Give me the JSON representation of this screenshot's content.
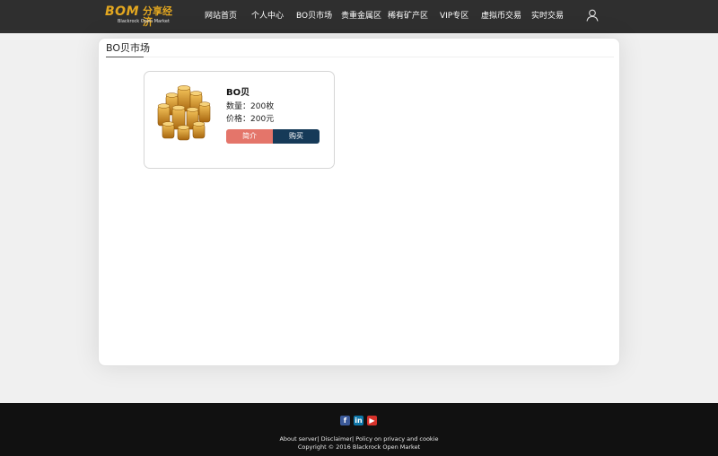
{
  "header": {
    "logo": {
      "mark": "BOM",
      "cn": "分享经济",
      "sub": "Blackrock Open Market"
    },
    "nav": [
      "网站首页",
      "个人中心",
      "BO贝市场",
      "贵重金属区",
      "稀有矿产区",
      "VIP专区",
      "虚拟币交易",
      "实时交易"
    ],
    "user_icon": "user-icon"
  },
  "main": {
    "title": "BO贝市场",
    "product": {
      "image_icon": "gold-coins-image",
      "name": "BO贝",
      "qty_label": "数量：",
      "qty_value": "200枚",
      "price_label": "价格：",
      "price_value": "200元",
      "intro_button": "简介",
      "buy_button": "购买"
    }
  },
  "footer": {
    "social": [
      {
        "icon": "facebook-icon",
        "glyph": "f",
        "color": "#3b5998"
      },
      {
        "icon": "linkedin-icon",
        "glyph": "in",
        "color": "#0e76a8"
      },
      {
        "icon": "youtube-icon",
        "glyph": "▶",
        "color": "#d6322b"
      }
    ],
    "links": [
      "About server|",
      "Disclaimer|",
      "Policy on privacy and cookie"
    ],
    "copyright": "Copyright © 2016 Blackrock Open Market"
  },
  "colors": {
    "header_bg": "#2f2f2f",
    "logo_gold": "#e3a720",
    "intro_btn": "#e4756a",
    "buy_btn": "#163a58",
    "footer_bg": "#111111"
  }
}
